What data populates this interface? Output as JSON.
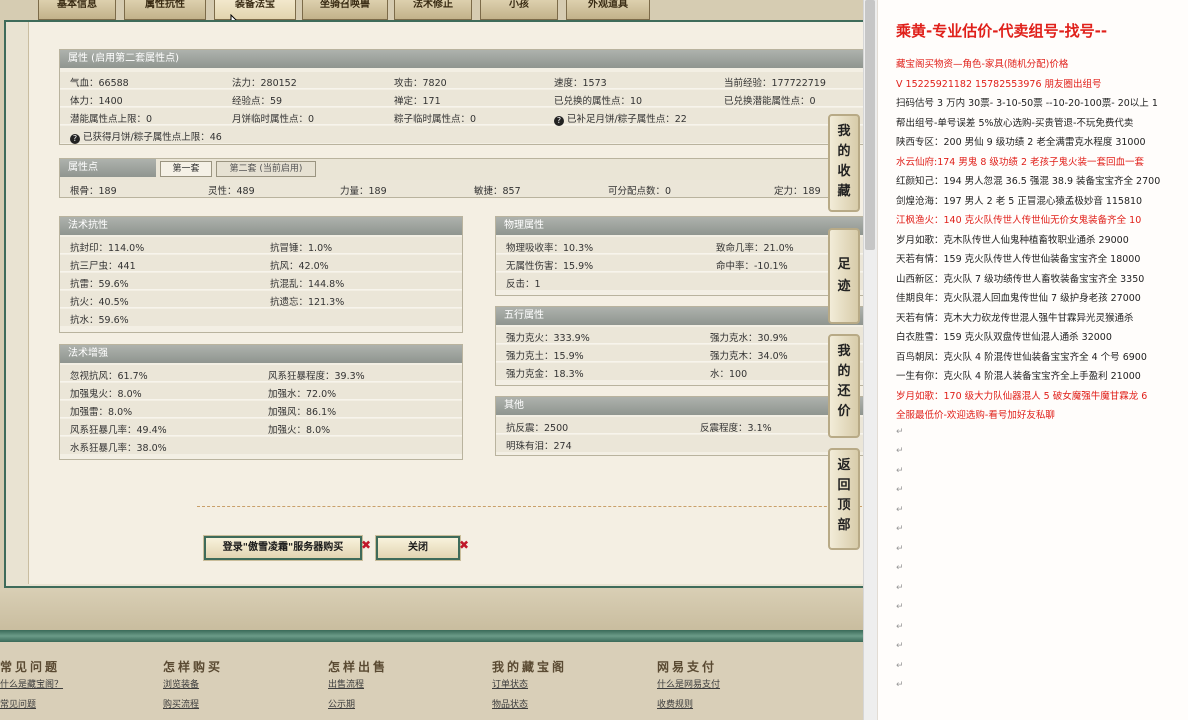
{
  "tabs": [
    "基本信息",
    "属性抗性",
    "装备法宝",
    "坐骑召唤兽",
    "法术修正",
    "小孩",
    "外观道具"
  ],
  "attr_panel": {
    "header": "属性 (启用第二套属性点)",
    "rows": [
      [
        "气血：66588",
        "法力：280152",
        "攻击：7820",
        "速度：1573",
        "当前经验：177722719"
      ],
      [
        "体力：1400",
        "经验点：59",
        "禅定：171",
        "已兑换的属性点：10",
        "已兑换潜能属性点：0"
      ],
      [
        "潜能属性点上限：0",
        "月饼临时属性点：0",
        "粽子临时属性点：0",
        "已补足月饼/粽子属性点：22"
      ]
    ],
    "note": "已获得月饼/粽子属性点上限：46",
    "help": "?"
  },
  "points_panel": {
    "header": "属性点",
    "tab1": "第一套",
    "tab2": "第二套 (当前启用)",
    "row": [
      "根骨：189",
      "灵性：489",
      "力量：189",
      "敏捷：857",
      "可分配点数：0",
      "定力：189"
    ]
  },
  "spell_resist": {
    "header": "法术抗性",
    "rows": [
      [
        "抗封印：114.0%",
        "抗冒锤：1.0%"
      ],
      [
        "抗三尸虫：441",
        "抗风：42.0%"
      ],
      [
        "抗雷：59.6%",
        "抗混乱：144.8%"
      ],
      [
        "抗火：40.5%",
        "抗遗忘：121.3%"
      ],
      [
        "抗水：59.6%",
        ""
      ]
    ]
  },
  "spell_boost": {
    "header": "法术增强",
    "rows": [
      [
        "忽视抗风：61.7%",
        "风系狂暴程度：39.3%"
      ],
      [
        "加强鬼火：8.0%",
        "加强水：72.0%"
      ],
      [
        "加强雷：8.0%",
        "加强风：86.1%"
      ],
      [
        "风系狂暴几率：49.4%",
        "加强火：8.0%"
      ],
      [
        "水系狂暴几率：38.0%",
        ""
      ]
    ]
  },
  "physical": {
    "header": "物理属性",
    "rows": [
      [
        "物理吸收率：10.3%",
        "致命几率：21.0%"
      ],
      [
        "无属性伤害：15.9%",
        "命中率：-10.1%"
      ],
      [
        "反击：1",
        ""
      ]
    ]
  },
  "elements": {
    "header": "五行属性",
    "rows": [
      [
        "强力克火：333.9%",
        "强力克水：30.9%"
      ],
      [
        "强力克土：15.9%",
        "强力克木：34.0%"
      ],
      [
        "强力克金：18.3%",
        "水：100"
      ]
    ]
  },
  "other": {
    "header": "其他",
    "rows": [
      [
        "抗反震：2500",
        "反震程度：3.1%"
      ],
      [
        "明珠有泪：274",
        ""
      ]
    ]
  },
  "buttons": {
    "buy": "登录\"傲雪凌霜\"服务器购买",
    "close": "关闭",
    "x": "✖"
  },
  "side_tabs": [
    "我的收藏",
    "足迹",
    "我的还价",
    "返回顶部"
  ],
  "footer": [
    {
      "title": "常见问题",
      "links": [
        "什么是藏宝阁？",
        "常见问题"
      ]
    },
    {
      "title": "怎样购买",
      "links": [
        "浏览装备",
        "购买流程"
      ]
    },
    {
      "title": "怎样出售",
      "links": [
        "出售流程",
        "公示期"
      ]
    },
    {
      "title": "我的藏宝阁",
      "links": [
        "订单状态",
        "物品状态"
      ]
    },
    {
      "title": "网易支付",
      "links": [
        "什么是网易支付",
        "收费规则"
      ]
    }
  ],
  "right_doc": {
    "title": "乘黄-专业估价-代卖组号-找号--",
    "lines": [
      {
        "t": "藏宝阁买物资—角色-家具(随机分配)价格",
        "red": true
      },
      {
        "t": "V 15225921182   15782553976 朋友圈出组号",
        "red": true
      },
      {
        "t": "扫码估号 3 万内 30票- 3-10-50票  --10-20-100票- 20以上 1",
        "red": false
      },
      {
        "t": "帮出组号-单号误差 5%放心选购-买贵管退-不玩免费代卖",
        "red": false
      },
      {
        "t": "陕西专区：200 男仙 9 级功绩 2 老全满雷克水程度 31000",
        "red": false
      },
      {
        "t": "水云仙府:174 男鬼 8 级功绩 2 老孩子鬼火装一套回血一套",
        "red": true
      },
      {
        "t": "红颜知己：194 男人忽混 36.5 强混 38.9 装备宝宝齐全 2700",
        "red": false
      },
      {
        "t": "剑煌沧海：197 男人 2 老 5 正冒混心猿孟极妙音 115810",
        "red": false
      },
      {
        "t": "江枫渔火：140 克火队传世人传世仙无价女鬼装备齐全 10",
        "red": true
      },
      {
        "t": "岁月如歌：克木队传世人仙鬼种植畜牧职业通杀 29000",
        "red": false
      },
      {
        "t": "天若有情：159 克火队传世人传世仙装备宝宝齐全 18000",
        "red": false
      },
      {
        "t": "山西新区：克火队 7 级功绩传世人畜牧装备宝宝齐全 3350",
        "red": false
      },
      {
        "t": "佳期良年：克火队混人回血鬼传世仙 7 级护身老孩 27000",
        "red": false
      },
      {
        "t": "天若有情：克木大力砍龙传世混人强牛甘霖异光灵猴通杀",
        "red": false
      },
      {
        "t": "白衣胜雪：159 克火队双盘传世仙混人通杀 32000",
        "red": false
      },
      {
        "t": "百鸟朝凤：克火队 4 阶混传世仙装备宝宝齐全 4 个号 6900",
        "red": false
      },
      {
        "t": "一生有你：克火队 4 阶混人装备宝宝齐全上手盈利 21000",
        "red": false
      },
      {
        "t": "岁月如歌：170 级大力队仙器混人 5 破女魔强牛魔甘霖龙 6",
        "red": true
      },
      {
        "t": "全服最低价-欢迎选购-看号加好友私聊",
        "red": true
      }
    ],
    "para_mark": "↵"
  }
}
